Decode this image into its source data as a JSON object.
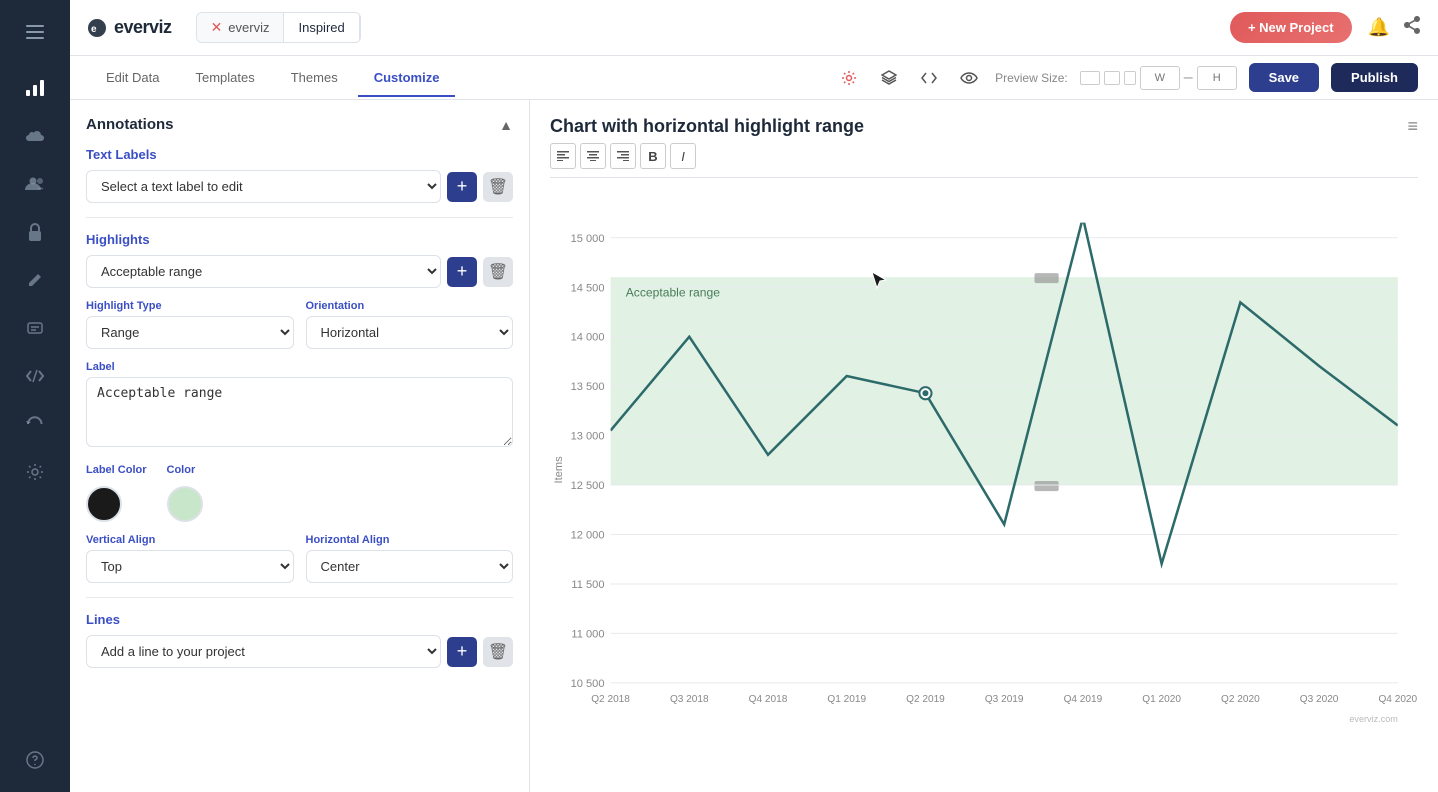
{
  "app": {
    "logo": "everviz",
    "logo_accent": "."
  },
  "header": {
    "breadcrumb_icon": "×",
    "project_name": "everviz",
    "template_name": "Inspired",
    "new_project_label": "+ New Project"
  },
  "tabs": {
    "items": [
      {
        "id": "edit-data",
        "label": "Edit Data"
      },
      {
        "id": "templates",
        "label": "Templates"
      },
      {
        "id": "themes",
        "label": "Themes"
      },
      {
        "id": "customize",
        "label": "Customize",
        "active": true
      }
    ]
  },
  "toolbar": {
    "save_label": "Save",
    "publish_label": "Publish",
    "preview_label": "Preview Size:"
  },
  "left_panel": {
    "section_title": "Annotations",
    "text_labels": {
      "title": "Text Labels",
      "select_placeholder": "Select a text label to edit"
    },
    "highlights": {
      "title": "Highlights",
      "select_value": "Acceptable range",
      "highlight_type_label": "Highlight Type",
      "highlight_type_value": "Range",
      "orientation_label": "Orientation",
      "orientation_value": "Horizontal",
      "label_field_label": "Label",
      "label_field_value": "Acceptable range",
      "label_color_label": "Label Color",
      "color_label": "Color",
      "vertical_align_label": "Vertical Align",
      "vertical_align_value": "Top",
      "horizontal_align_label": "Horizontal Align",
      "horizontal_align_value": "Center"
    },
    "lines": {
      "title": "Lines",
      "select_placeholder": "Add a line to your project"
    }
  },
  "chart": {
    "title": "Chart with horizontal highlight range",
    "y_axis_label": "Items",
    "credit": "everviz.com",
    "highlight_label": "Acceptable range",
    "x_labels": [
      "Q2 2018",
      "Q3 2018",
      "Q4 2018",
      "Q1 2019",
      "Q2 2019",
      "Q3 2019",
      "Q4 2019",
      "Q1 2020",
      "Q2 2020",
      "Q3 2020",
      "Q4 2020"
    ],
    "y_ticks": [
      10500,
      11000,
      11500,
      12000,
      12500,
      13000,
      13500,
      14000,
      14500,
      15000
    ],
    "series": [
      {
        "x": 0.0,
        "y": 13050
      },
      {
        "x": 0.1,
        "y": 14000
      },
      {
        "x": 0.2,
        "y": 12800
      },
      {
        "x": 0.3,
        "y": 13600
      },
      {
        "x": 0.4,
        "y": 13430
      },
      {
        "x": 0.5,
        "y": 12100
      },
      {
        "x": 0.6,
        "y": 15200
      },
      {
        "x": 0.7,
        "y": 11700
      },
      {
        "x": 0.8,
        "y": 14350
      },
      {
        "x": 0.9,
        "y": 13700
      },
      {
        "x": 1.0,
        "y": 13100
      }
    ],
    "highlight_min": 12500,
    "highlight_max": 14500
  }
}
